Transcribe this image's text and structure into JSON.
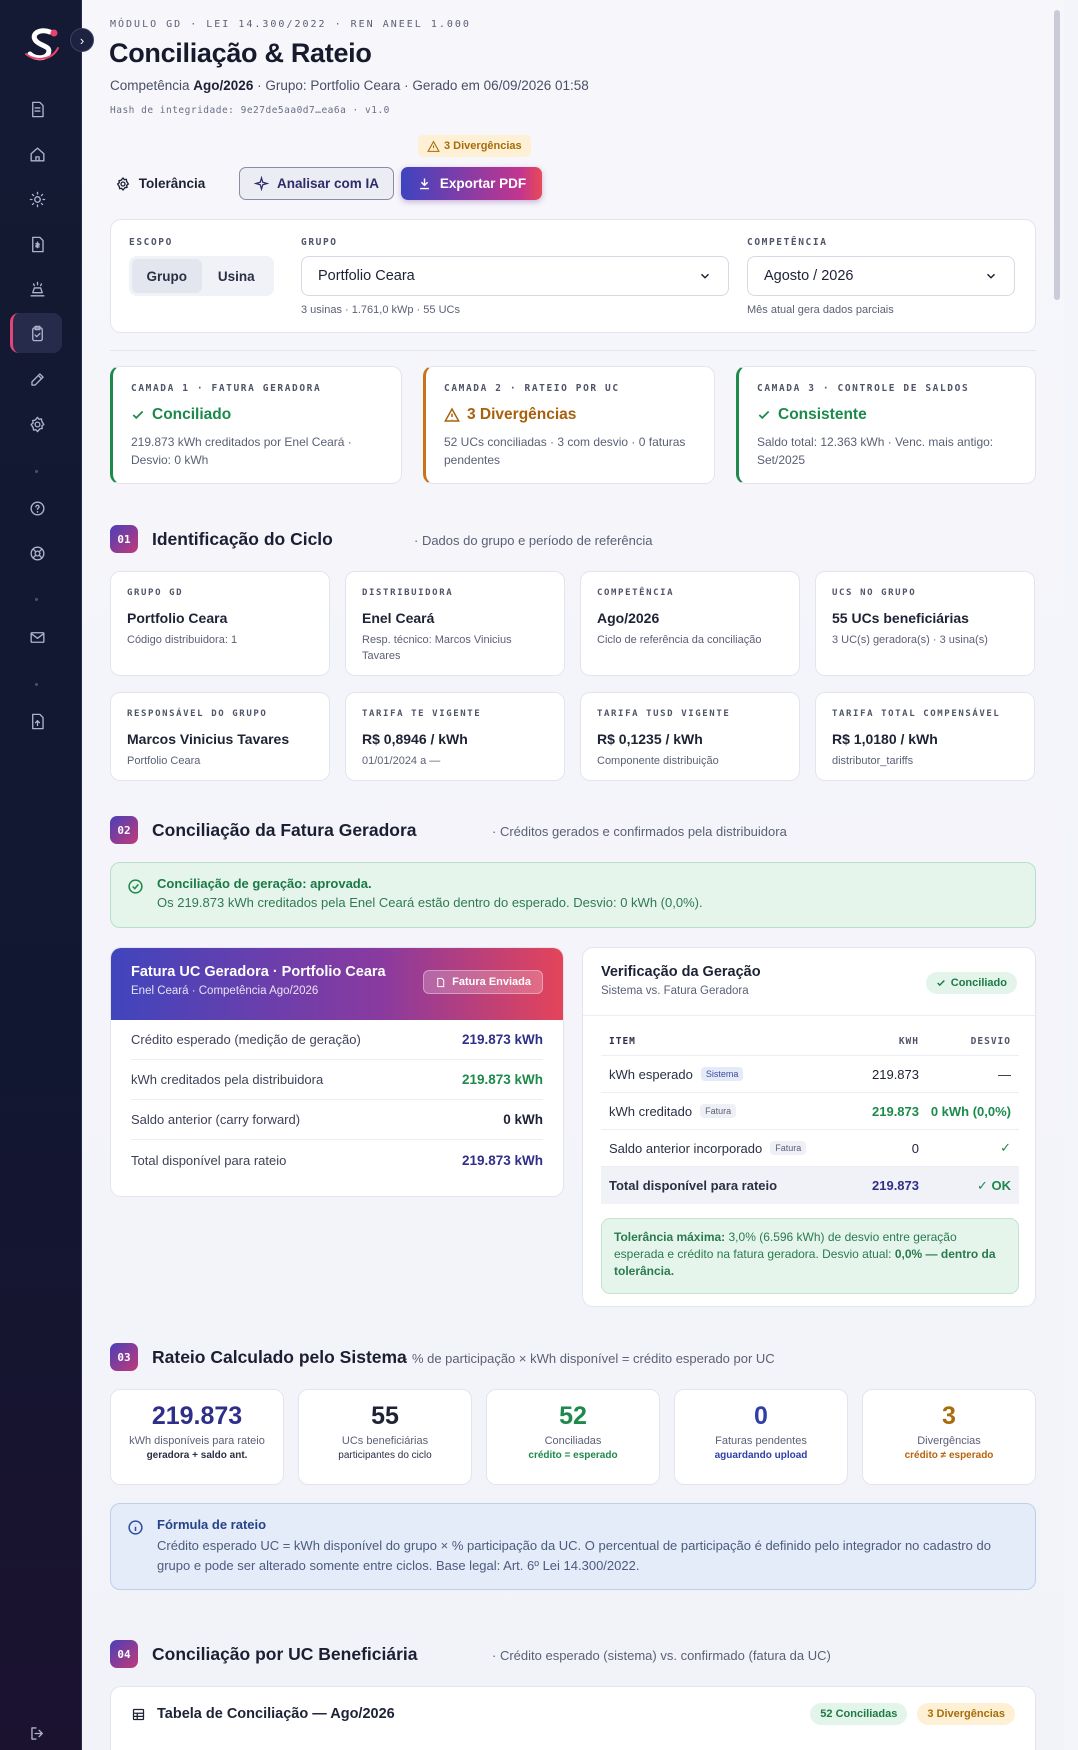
{
  "header": {
    "eyebrow": "MÓDULO GD · LEI 14.300/2022 · REN ANEEL 1.000",
    "title": "Conciliação & Rateio",
    "subtitle_prefix": "Competência ",
    "subtitle_period": "Ago/2026",
    "subtitle_rest": " · Grupo: Portfolio Ceara · Gerado em 06/09/2026 01:58",
    "hash": "Hash de integridade: 9e27de5aa0d7…ea6a · v1.0",
    "divergence_badge": "3 Divergências",
    "btn_tolerance": "Tolerância",
    "btn_ai": "Analisar com IA",
    "btn_pdf": "Exportar PDF"
  },
  "filters": {
    "scope_label": "ESCOPO",
    "scope_options": [
      "Grupo",
      "Usina"
    ],
    "group_label": "GRUPO",
    "group_value": "Portfolio Ceara",
    "group_hint": "3 usinas · 1.761,0 kWp · 55 UCs",
    "period_label": "COMPETÊNCIA",
    "period_value": "Agosto / 2026",
    "period_hint": "Mês atual gera dados parciais"
  },
  "layers": [
    {
      "label": "CAMADA 1 · FATURA GERADORA",
      "status": "Conciliado",
      "desc": "219.873 kWh creditados por Enel Ceará · Desvio: 0 kWh",
      "color": "#1d8a4c"
    },
    {
      "label": "CAMADA 2 · RATEIO POR UC",
      "status": "3 Divergências",
      "desc": "52 UCs conciliadas · 3 com desvio · 0 faturas pendentes",
      "color": "#b7640c"
    },
    {
      "label": "CAMADA 3 · CONTROLE DE SALDOS",
      "status": "Consistente",
      "desc": "Saldo total: 12.363 kWh · Venc. mais antigo: Set/2025",
      "color": "#1d8a4c"
    }
  ],
  "section1": {
    "num": "01",
    "title": "Identificação do Ciclo",
    "sub": "· Dados do grupo e período de referência",
    "cards": [
      {
        "label": "GRUPO GD",
        "value": "Portfolio Ceara",
        "hint": "Código distribuidora: 1"
      },
      {
        "label": "DISTRIBUIDORA",
        "value": "Enel Ceará",
        "hint": "Resp. técnico: Marcos Vinicius Tavares"
      },
      {
        "label": "COMPETÊNCIA",
        "value": "Ago/2026",
        "hint": "Ciclo de referência da conciliação"
      },
      {
        "label": "UCS NO GRUPO",
        "value": "55 UCs beneficiárias",
        "hint": "3 UC(s) geradora(s) · 3 usina(s)"
      },
      {
        "label": "RESPONSÁVEL DO GRUPO",
        "value": "Marcos Vinicius Tavares",
        "hint": "Portfolio Ceara"
      },
      {
        "label": "TARIFA TE VIGENTE",
        "value": "R$ 0,8946 / kWh",
        "hint": "01/01/2024 a —"
      },
      {
        "label": "TARIFA TUSD VIGENTE",
        "value": "R$ 0,1235 / kWh",
        "hint": "Componente distribuição"
      },
      {
        "label": "TARIFA TOTAL COMPENSÁVEL",
        "value": "R$ 1,0180 / kWh",
        "hint": "distributor_tariffs"
      }
    ]
  },
  "section2": {
    "num": "02",
    "title": "Conciliação da Fatura Geradora",
    "sub": "· Créditos gerados e confirmados pela distribuidora",
    "alert_title": "Conciliação de geração: aprovada.",
    "alert_desc": "Os 219.873 kWh creditados pela Enel Ceará estão dentro do esperado. Desvio: 0 kWh (0,0%).",
    "fatura": {
      "title": "Fatura UC Geradora · Portfolio Ceara",
      "sub": "Enel Ceará · Competência Ago/2026",
      "pill": "Fatura Enviada",
      "rows": [
        {
          "label": "Crédito esperado (medição de geração)",
          "value": "219.873 kWh",
          "color": "#2f2f8a"
        },
        {
          "label": "kWh creditados pela distribuidora",
          "value": "219.873 kWh",
          "color": "#1d8a4c"
        },
        {
          "label": "Saldo anterior (carry forward)",
          "value": "0 kWh",
          "color": "#1e2235"
        },
        {
          "label": "Total disponível para rateio",
          "value": "219.873 kWh",
          "color": "#2f2f8a"
        }
      ]
    },
    "verif": {
      "title": "Verificação da Geração",
      "sub": "Sistema vs. Fatura Geradora",
      "pill": "Conciliado",
      "headers": [
        "ITEM",
        "KWH",
        "DESVIO"
      ],
      "rows": [
        {
          "item": "kWh esperado",
          "tag": "Sistema",
          "kwh": "219.873",
          "desvio": "—"
        },
        {
          "item": "kWh creditado",
          "tag": "Fatura",
          "kwh": "219.873",
          "desvio": "0 kWh (0,0%)"
        },
        {
          "item": "Saldo anterior incorporado",
          "tag": "Fatura",
          "kwh": "0",
          "desvio": "✓"
        },
        {
          "item": "Total disponível para rateio",
          "tag": "",
          "kwh": "219.873",
          "desvio": "✓ OK"
        }
      ],
      "tol_label": "Tolerância máxima:",
      "tol_text": " 3,0% (6.596 kWh) de desvio entre geração esperada e crédito na fatura geradora. Desvio atual: ",
      "tol_strong": "0,0% — dentro da tolerância."
    }
  },
  "section3": {
    "num": "03",
    "title": "Rateio Calculado pelo Sistema",
    "sub": "· % de participação × kWh disponível = crédito esperado por UC",
    "stats": [
      {
        "value": "219.873",
        "l1": "kWh disponíveis para rateio",
        "l2": "geradora + saldo ant.",
        "color": "#2f2f8a",
        "c2": "#2b2f45"
      },
      {
        "value": "55",
        "l1": "UCs beneficiárias",
        "l2": "participantes do ciclo",
        "color": "#1e2235",
        "c2": "#2b2f45"
      },
      {
        "value": "52",
        "l1": "Conciliadas",
        "l2": "crédito = esperado",
        "color": "#1d8a4c",
        "c2": "#1d8a4c"
      },
      {
        "value": "0",
        "l1": "Faturas pendentes",
        "l2": "aguardando upload",
        "color": "#2f3fa8",
        "c2": "#2f3fa8"
      },
      {
        "value": "3",
        "l1": "Divergências",
        "l2": "crédito ≠ esperado",
        "color": "#a86c0a",
        "c2": "#b7640c"
      }
    ],
    "formula_title": "Fórmula de rateio",
    "formula_desc": "Crédito esperado UC = kWh disponível do grupo × % participação da UC. O percentual de participação é definido pelo integrador no cadastro do grupo e pode ser alterado somente entre ciclos. Base legal: Art. 6º Lei 14.300/2022."
  },
  "section4": {
    "num": "04",
    "title": "Conciliação por UC Beneficiária",
    "sub": "· Crédito esperado (sistema) vs. confirmado (fatura da UC)",
    "table_title": "Tabela de Conciliação — Ago/2026",
    "pill_ok": "52 Conciliadas",
    "pill_div": "3 Divergências"
  }
}
